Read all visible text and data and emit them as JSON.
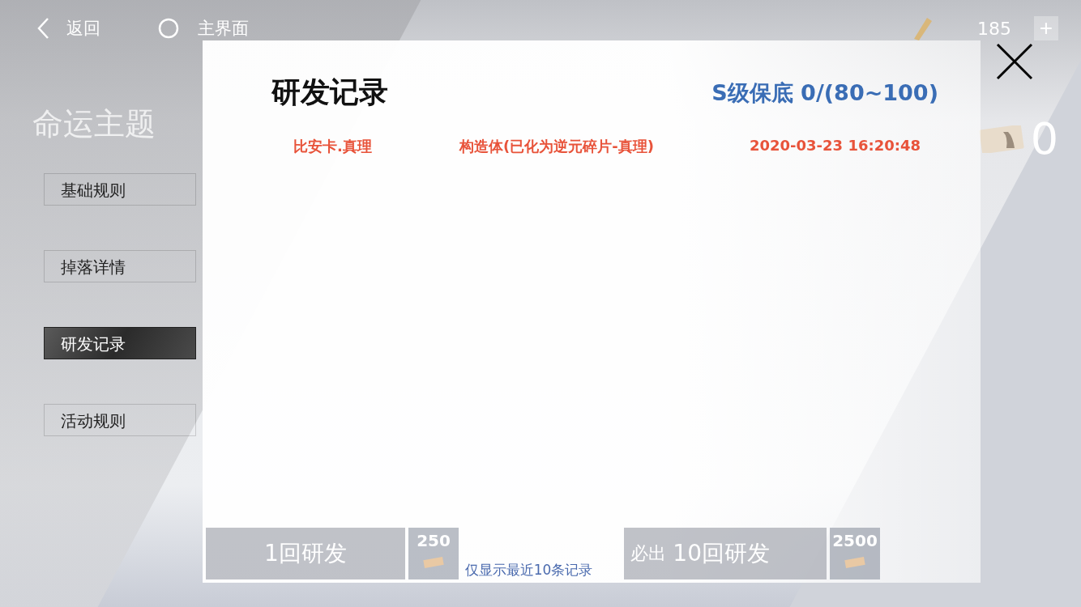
{
  "top_bar": {
    "back_label": "返回",
    "home_label": "主界面",
    "currency_amount": "185",
    "add_symbol": "+"
  },
  "background": {
    "event_title": "命运主题",
    "count": "0",
    "draw_buttons": [
      {
        "label": "1回研发",
        "cost": "250"
      },
      {
        "label": "10回研发",
        "cost": "2500",
        "badge": "必出"
      }
    ]
  },
  "tabs": [
    {
      "label": "基础规则",
      "selected": false
    },
    {
      "label": "掉落详情",
      "selected": false
    },
    {
      "label": "研发记录",
      "selected": true
    },
    {
      "label": "活动规则",
      "selected": false
    }
  ],
  "dialog": {
    "title": "研发记录",
    "pity": "S级保底 0/(80~100)",
    "records": [
      {
        "name": "比安卡.真理",
        "type": "构造体(已化为逆元碎片-真理)",
        "time": "2020-03-23 16:20:48"
      }
    ],
    "footnote": "仅显示最近10条记录"
  }
}
